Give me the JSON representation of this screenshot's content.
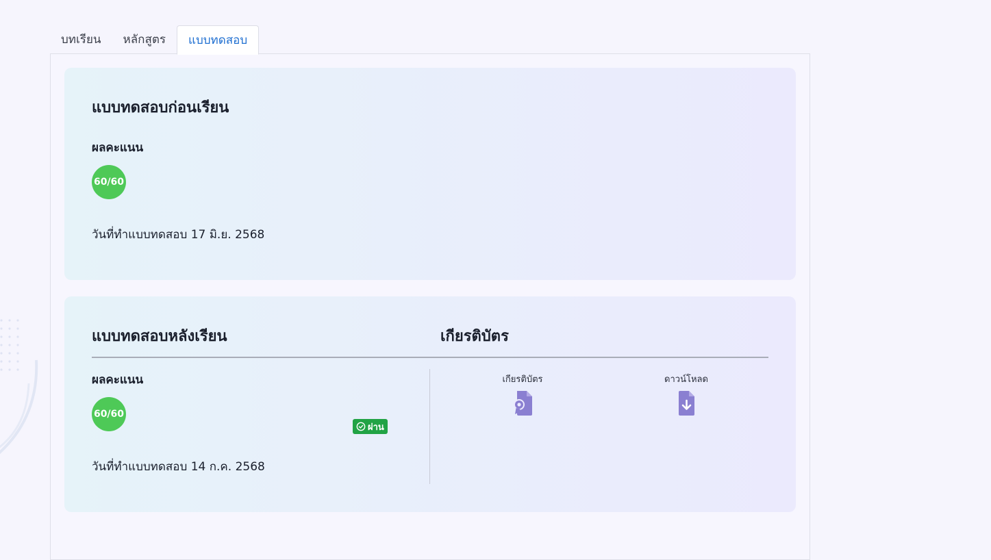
{
  "tabs": [
    {
      "label": "บทเรียน",
      "active": false
    },
    {
      "label": "หลักสูตร",
      "active": false
    },
    {
      "label": "แบบทดสอบ",
      "active": true
    }
  ],
  "pre_test": {
    "title": "แบบทดสอบก่อนเรียน",
    "score_label": "ผลคะแนน",
    "score": "60/60",
    "date_text": "วันที่ทำแบบทดสอบ 17 มิ.ย. 2568"
  },
  "post_test": {
    "title": "แบบทดสอบหลังเรียน",
    "score_label": "ผลคะแนน",
    "score": "60/60",
    "status": "ผ่าน",
    "date_text": "วันที่ทำแบบทดสอบ 14 ก.ค. 2568"
  },
  "certificate": {
    "title": "เกียรติบัตร",
    "view_label": "เกียรติบัตร",
    "view_icon": "certificate-icon",
    "download_label": "ดาวน์โหลด",
    "download_icon": "file-download-icon"
  },
  "colors": {
    "score_badge": "#4ec957",
    "pass_badge": "#21a345",
    "icon": "#8a7fd1",
    "active_tab": "#1f6fd1"
  }
}
